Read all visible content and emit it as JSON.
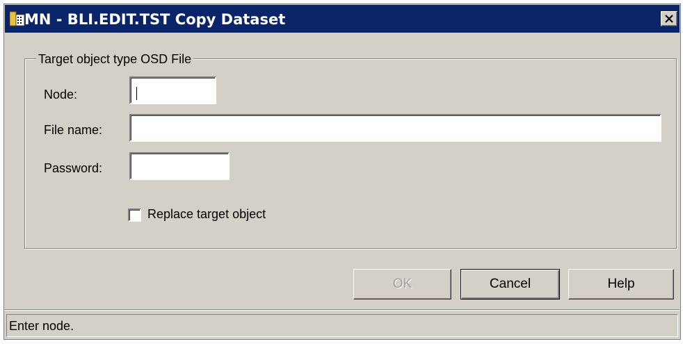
{
  "window": {
    "title": "MN - BLI.EDIT.TST Copy Dataset",
    "icon": "dataset-app-icon",
    "close_icon": "close-icon"
  },
  "group": {
    "label": "Target object type OSD File"
  },
  "fields": {
    "node_label": "Node:",
    "node_value": "",
    "filename_label": "File name:",
    "filename_value": "",
    "password_label": "Password:",
    "password_value": ""
  },
  "replace_checkbox": {
    "label": "Replace target object",
    "checked": false
  },
  "buttons": {
    "ok": "OK",
    "cancel": "Cancel",
    "help": "Help"
  },
  "status": {
    "text": "Enter node."
  },
  "colors": {
    "titlebar": "#0a246a",
    "face": "#d4d0c8",
    "disabled_text": "#a0a0a0"
  }
}
